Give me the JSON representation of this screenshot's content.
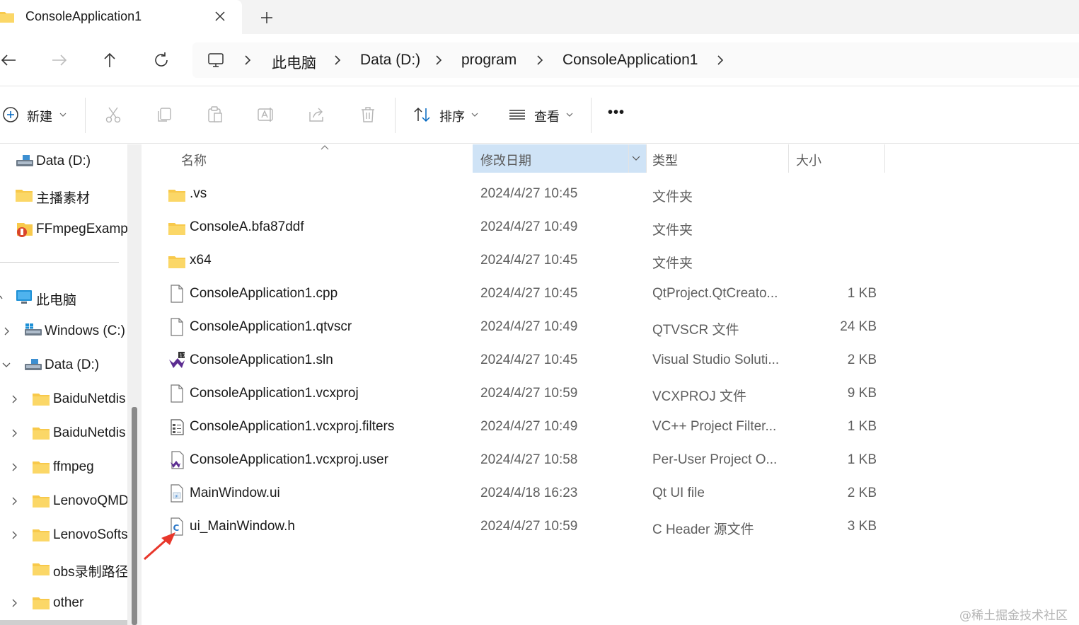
{
  "tab": {
    "title": "ConsoleApplication1",
    "close_icon": "close-icon",
    "new_icon": "plus-icon"
  },
  "nav": {
    "back": "arrow-left-icon",
    "forward": "arrow-right-icon",
    "up": "arrow-up-icon",
    "refresh": "refresh-icon"
  },
  "breadcrumb": [
    "此电脑",
    "Data (D:)",
    "program",
    "ConsoleApplication1"
  ],
  "toolbar": {
    "new_label": "新建",
    "sort_label": "排序",
    "view_label": "查看",
    "more_label": "•••"
  },
  "sidebar": {
    "quick": [
      {
        "label": "Data (D:)",
        "icon": "drive-icon"
      },
      {
        "label": "主播素材",
        "icon": "folder-icon"
      },
      {
        "label": "FFmpegExamp",
        "icon": "ppt-icon"
      }
    ],
    "tree": [
      {
        "label": "此电脑",
        "icon": "pc-icon",
        "chevron": ""
      },
      {
        "label": "Windows (C:)",
        "icon": "windows-drive-icon",
        "chevron": "right"
      },
      {
        "label": "Data (D:)",
        "icon": "drive-icon",
        "chevron": "down"
      },
      {
        "label": "BaiduNetdis",
        "icon": "folder-icon",
        "chevron": "right"
      },
      {
        "label": "BaiduNetdis",
        "icon": "folder-icon",
        "chevron": "right"
      },
      {
        "label": "ffmpeg",
        "icon": "folder-icon",
        "chevron": "right"
      },
      {
        "label": "LenovoQMD",
        "icon": "folder-icon",
        "chevron": "right"
      },
      {
        "label": "LenovoSofts",
        "icon": "folder-icon",
        "chevron": "right"
      },
      {
        "label": "obs录制路径",
        "icon": "folder-icon",
        "chevron": ""
      },
      {
        "label": "other",
        "icon": "folder-icon",
        "chevron": "right"
      }
    ]
  },
  "columns": {
    "name": "名称",
    "date": "修改日期",
    "type": "类型",
    "size": "大小"
  },
  "files": [
    {
      "name": ".vs",
      "date": "2024/4/27 10:45",
      "type": "文件夹",
      "size": "",
      "icon": "folder-icon"
    },
    {
      "name": "ConsoleA.bfa87ddf",
      "date": "2024/4/27 10:49",
      "type": "文件夹",
      "size": "",
      "icon": "folder-icon"
    },
    {
      "name": "x64",
      "date": "2024/4/27 10:45",
      "type": "文件夹",
      "size": "",
      "icon": "folder-icon"
    },
    {
      "name": "ConsoleApplication1.cpp",
      "date": "2024/4/27 10:45",
      "type": "QtProject.QtCreato...",
      "size": "1 KB",
      "icon": "file-icon"
    },
    {
      "name": "ConsoleApplication1.qtvscr",
      "date": "2024/4/27 10:49",
      "type": "QTVSCR 文件",
      "size": "24 KB",
      "icon": "file-icon"
    },
    {
      "name": "ConsoleApplication1.sln",
      "date": "2024/4/27 10:45",
      "type": "Visual Studio Soluti...",
      "size": "2 KB",
      "icon": "vs-solution-icon"
    },
    {
      "name": "ConsoleApplication1.vcxproj",
      "date": "2024/4/27 10:59",
      "type": "VCXPROJ 文件",
      "size": "9 KB",
      "icon": "file-icon"
    },
    {
      "name": "ConsoleApplication1.vcxproj.filters",
      "date": "2024/4/27 10:49",
      "type": "VC++ Project Filter...",
      "size": "1 KB",
      "icon": "filters-file-icon"
    },
    {
      "name": "ConsoleApplication1.vcxproj.user",
      "date": "2024/4/27 10:58",
      "type": "Per-User Project O...",
      "size": "1 KB",
      "icon": "vs-user-file-icon"
    },
    {
      "name": "MainWindow.ui",
      "date": "2024/4/18 16:23",
      "type": "Qt UI file",
      "size": "2 KB",
      "icon": "ui-file-icon"
    },
    {
      "name": "ui_MainWindow.h",
      "date": "2024/4/27 10:59",
      "type": "C Header 源文件",
      "size": "3 KB",
      "icon": "c-header-icon"
    }
  ],
  "watermark": "@稀土掘金技术社区",
  "colors": {
    "selected_header": "#cfe3f6",
    "folder": "#f8c94b",
    "arrow": "#e8372b",
    "accent": "#0067c0"
  }
}
